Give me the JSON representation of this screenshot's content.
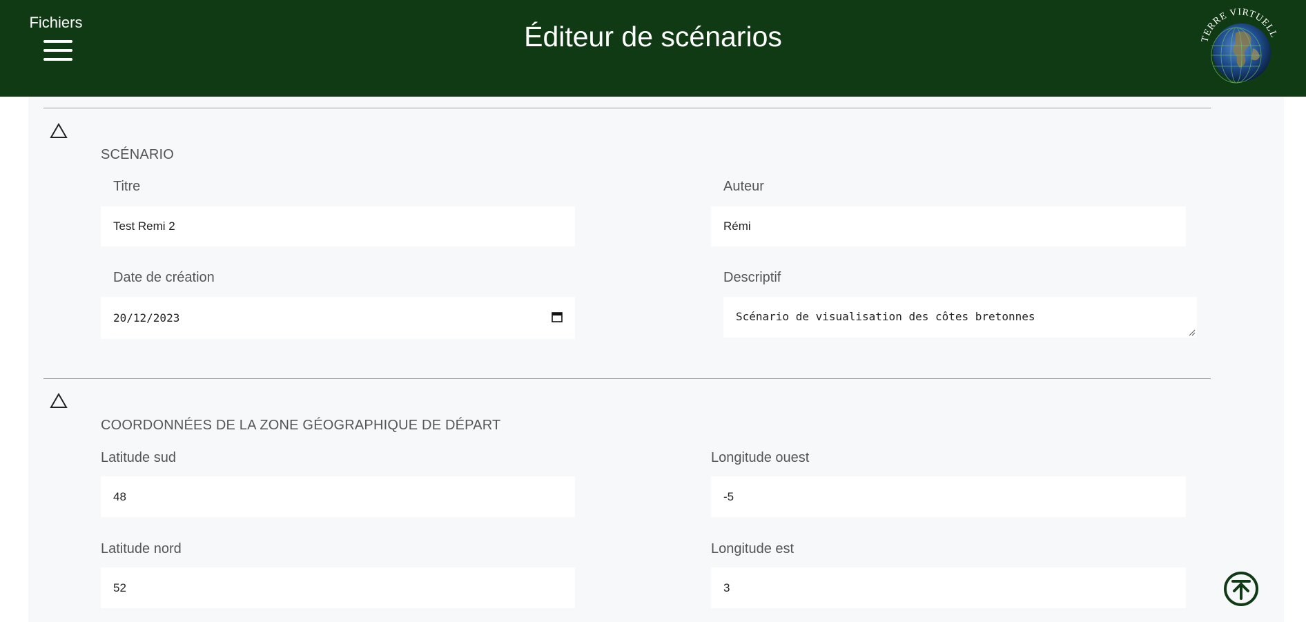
{
  "header": {
    "menu_label": "Fichiers",
    "title": "Éditeur de scénarios",
    "logo_text": "Terre Virtuelle",
    "background": "#103a14"
  },
  "icons": {
    "menu": "hamburger-icon",
    "collapse": "triangle-up-icon",
    "calendar": "calendar-icon",
    "scroll_top": "arrow-up-circle-icon"
  },
  "scenario": {
    "section_title": "SCÉNARIO",
    "title_label": "Titre",
    "title_value": "Test Remi 2",
    "author_label": "Auteur",
    "author_value": "Rémi",
    "date_label": "Date de création",
    "date_value": "20/12/2023",
    "description_label": "Descriptif",
    "description_value": "Scénario de visualisation des côtes bretonnes"
  },
  "zone": {
    "section_title": "COORDONNÉES DE LA ZONE GÉOGRAPHIQUE DE DÉPART",
    "lat_south_label": "Latitude sud",
    "lat_south_value": "48",
    "lon_west_label": "Longitude ouest",
    "lon_west_value": "-5",
    "lat_north_label": "Latitude nord",
    "lat_north_value": "52",
    "lon_east_label": "Longitude est",
    "lon_east_value": "3"
  }
}
